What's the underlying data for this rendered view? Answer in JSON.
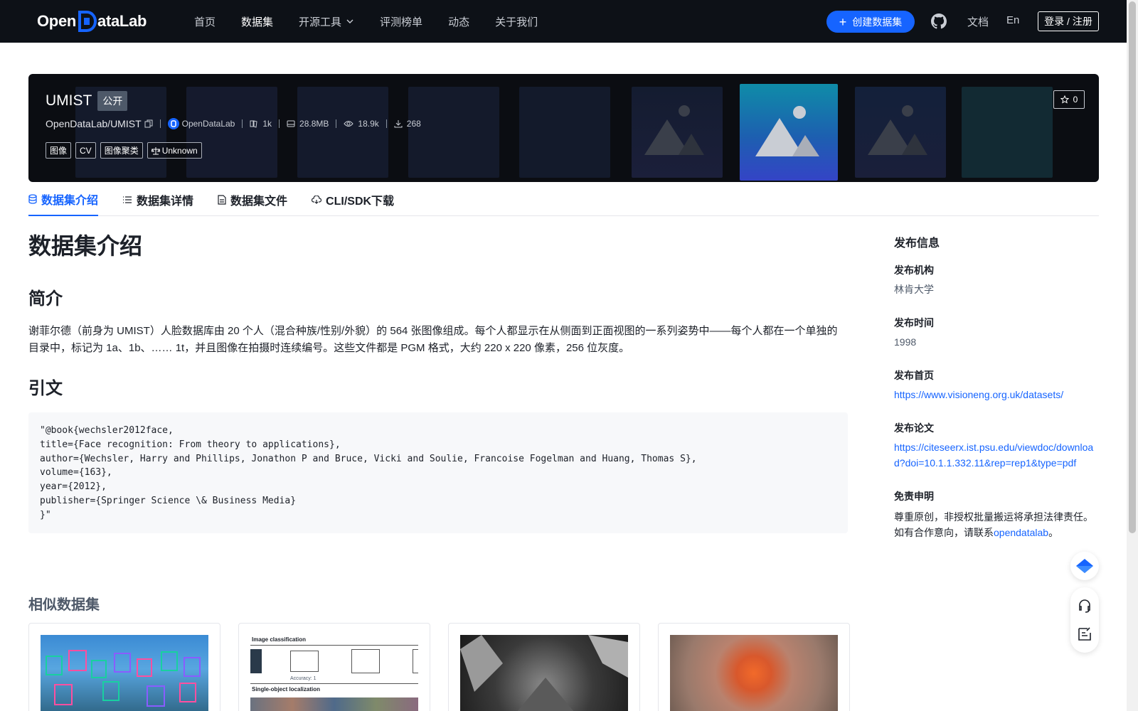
{
  "nav": {
    "logo_text_a": "Open",
    "logo_text_b": "ataLab",
    "links": [
      "首页",
      "数据集",
      "开源工具",
      "评测榜单",
      "动态",
      "关于我们"
    ],
    "active_link": "数据集",
    "create_label": "创建数据集",
    "docs_label": "文档",
    "lang_label": "En",
    "login_label": "登录 / 注册"
  },
  "dataset": {
    "name": "UMIST",
    "visibility": "公开",
    "repo": "OpenDataLab/UMIST",
    "org": "OpenDataLab",
    "file_count": "1k",
    "size": "28.8MB",
    "views": "18.9k",
    "downloads": "268",
    "tags": [
      "图像",
      "CV",
      "图像聚类",
      "Unknown"
    ],
    "stars": "0"
  },
  "tabs": [
    {
      "label": "数据集介绍",
      "icon": "database-icon"
    },
    {
      "label": "数据集详情",
      "icon": "list-icon"
    },
    {
      "label": "数据集文件",
      "icon": "file-icon"
    },
    {
      "label": "CLI/SDK下载",
      "icon": "cloud-download-icon"
    }
  ],
  "content": {
    "title": "数据集介绍",
    "intro_heading": "简介",
    "intro_text": "谢菲尔德（前身为 UMIST）人脸数据库由 20 个人（混合种族/性别/外貌）的 564 张图像组成。每个人都显示在从侧面到正面视图的一系列姿势中——每个人都在一个单独的目录中，标记为 1a、1b、…… 1t，并且图像在拍摄时连续编号。这些文件都是 PGM 格式，大约 220 x 220 像素，256 位灰度。",
    "cite_heading": "引文",
    "citation": "\"@book{wechsler2012face,\ntitle={Face recognition: From theory to applications},\nauthor={Wechsler, Harry and Phillips, Jonathon P and Bruce, Vicki and Soulie, Francoise Fogelman and Huang, Thomas S},\nvolume={163},\nyear={2012},\npublisher={Springer Science \\& Business Media}\n}\""
  },
  "sidebar": {
    "title": "发布信息",
    "org_label": "发布机构",
    "org_value": "林肯大学",
    "time_label": "发布时间",
    "time_value": "1998",
    "home_label": "发布首页",
    "home_url": "https://www.visioneng.org.uk/datasets/",
    "paper_label": "发布论文",
    "paper_url": "https://citeseerx.ist.psu.edu/viewdoc/download?doi=10.1.1.332.11&rep=rep1&type=pdf",
    "paper_line1": "https://citeseerx.ist.psu.edu/viewdoc/downloa",
    "paper_line2": "d?doi=10.1.1.332.11&rep=rep1&type=pdf",
    "disclaimer_label": "免责申明",
    "disclaimer_text": "尊重原创，非授权批量搬运将承担法律责任。",
    "disclaimer_prefix": "如有合作意向，请联系",
    "disclaimer_link": "opendatalab",
    "disclaimer_suffix": "。"
  },
  "similar": {
    "title": "相似数据集",
    "card_b_text1": "Image classification",
    "card_b_text2": "Single-object localization",
    "card_b_label": "Accuracy: 1"
  }
}
